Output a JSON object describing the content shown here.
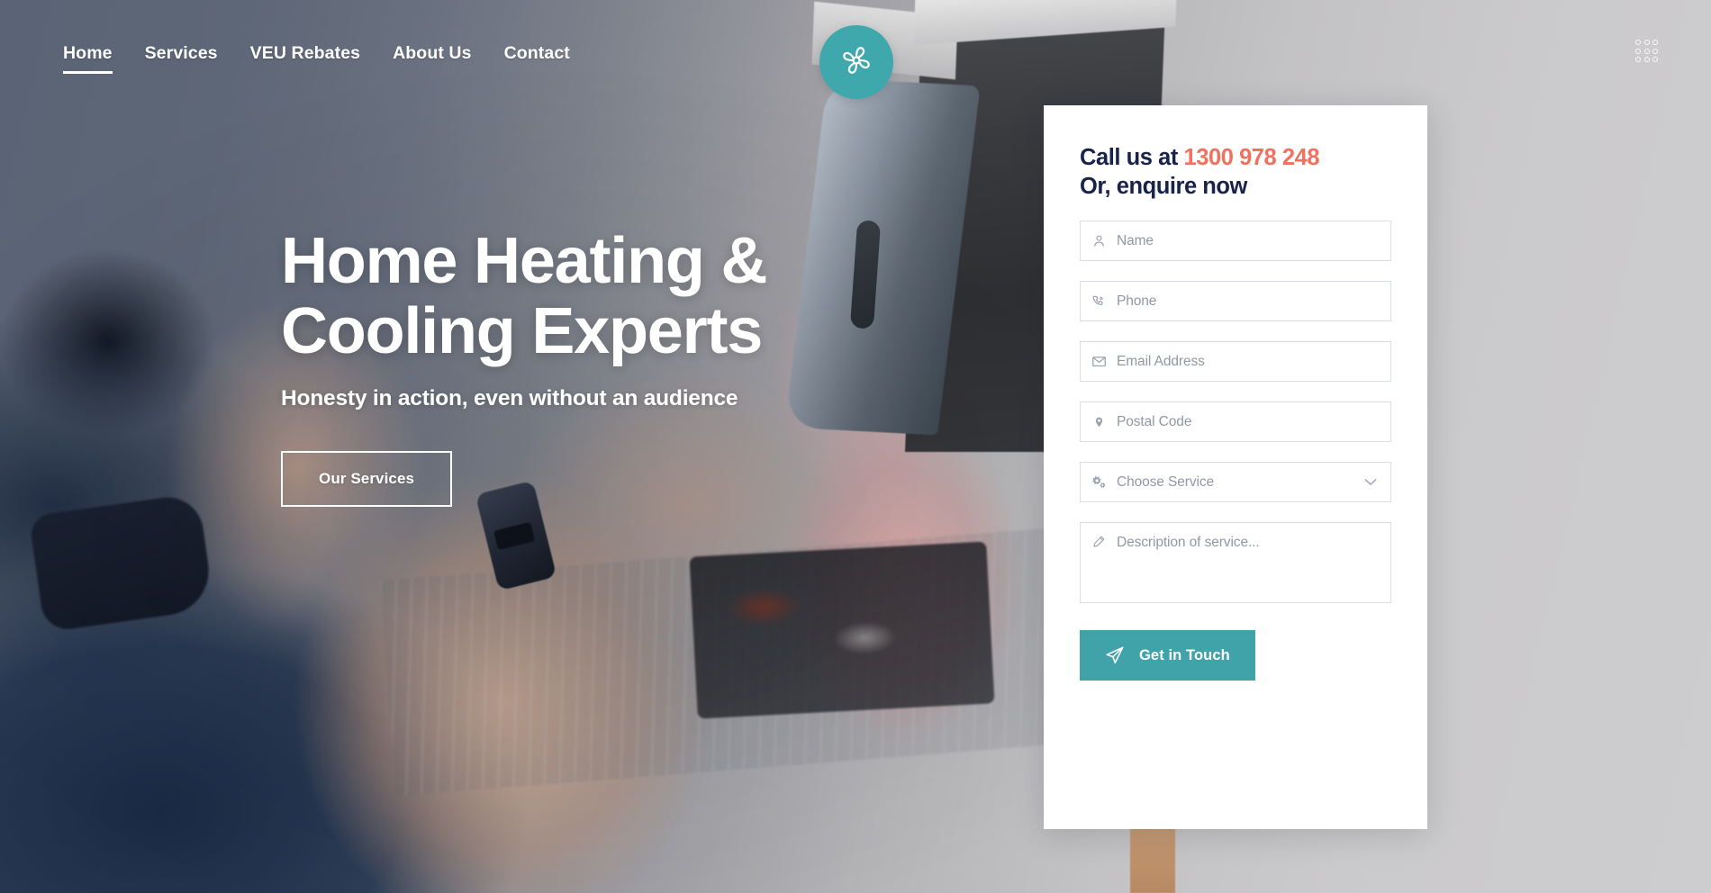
{
  "nav": {
    "items": [
      {
        "label": "Home",
        "active": true
      },
      {
        "label": "Services",
        "active": false
      },
      {
        "label": "VEU Rebates",
        "active": false
      },
      {
        "label": "About Us",
        "active": false
      },
      {
        "label": "Contact",
        "active": false
      }
    ]
  },
  "logo": {
    "icon": "fan-icon",
    "color": "#3FA8AD"
  },
  "grid_menu": {
    "icon": "grid-dots-icon",
    "dots": 9
  },
  "hero": {
    "title_line1": "Home Heating &",
    "title_line2": "Cooling Experts",
    "subtitle": "Honesty in action, even without an audience",
    "cta_label": "Our Services"
  },
  "enquiry": {
    "heading_prefix": "Call us at ",
    "phone": "1300 978 248",
    "heading_line2": "Or, enquire now",
    "fields": [
      {
        "name": "name",
        "icon": "user-icon",
        "placeholder": "Name",
        "value": ""
      },
      {
        "name": "phone",
        "icon": "phone-icon",
        "placeholder": "Phone",
        "value": ""
      },
      {
        "name": "email",
        "icon": "envelope-icon",
        "placeholder": "Email Address",
        "value": ""
      },
      {
        "name": "postal",
        "icon": "location-pin-icon",
        "placeholder": "Postal Code",
        "value": ""
      },
      {
        "name": "service",
        "icon": "gears-icon",
        "placeholder": "Choose Service",
        "value": ""
      },
      {
        "name": "description",
        "icon": "pencil-icon",
        "placeholder": "Description of service...",
        "value": ""
      }
    ],
    "submit_label": "Get in Touch",
    "submit_icon": "paper-plane-icon"
  },
  "colors": {
    "teal": "#3FA3A9",
    "coral": "#F2715E",
    "navy": "#17234A",
    "placeholder_gray": "#9297A3",
    "border_gray": "#D9DDE4"
  }
}
